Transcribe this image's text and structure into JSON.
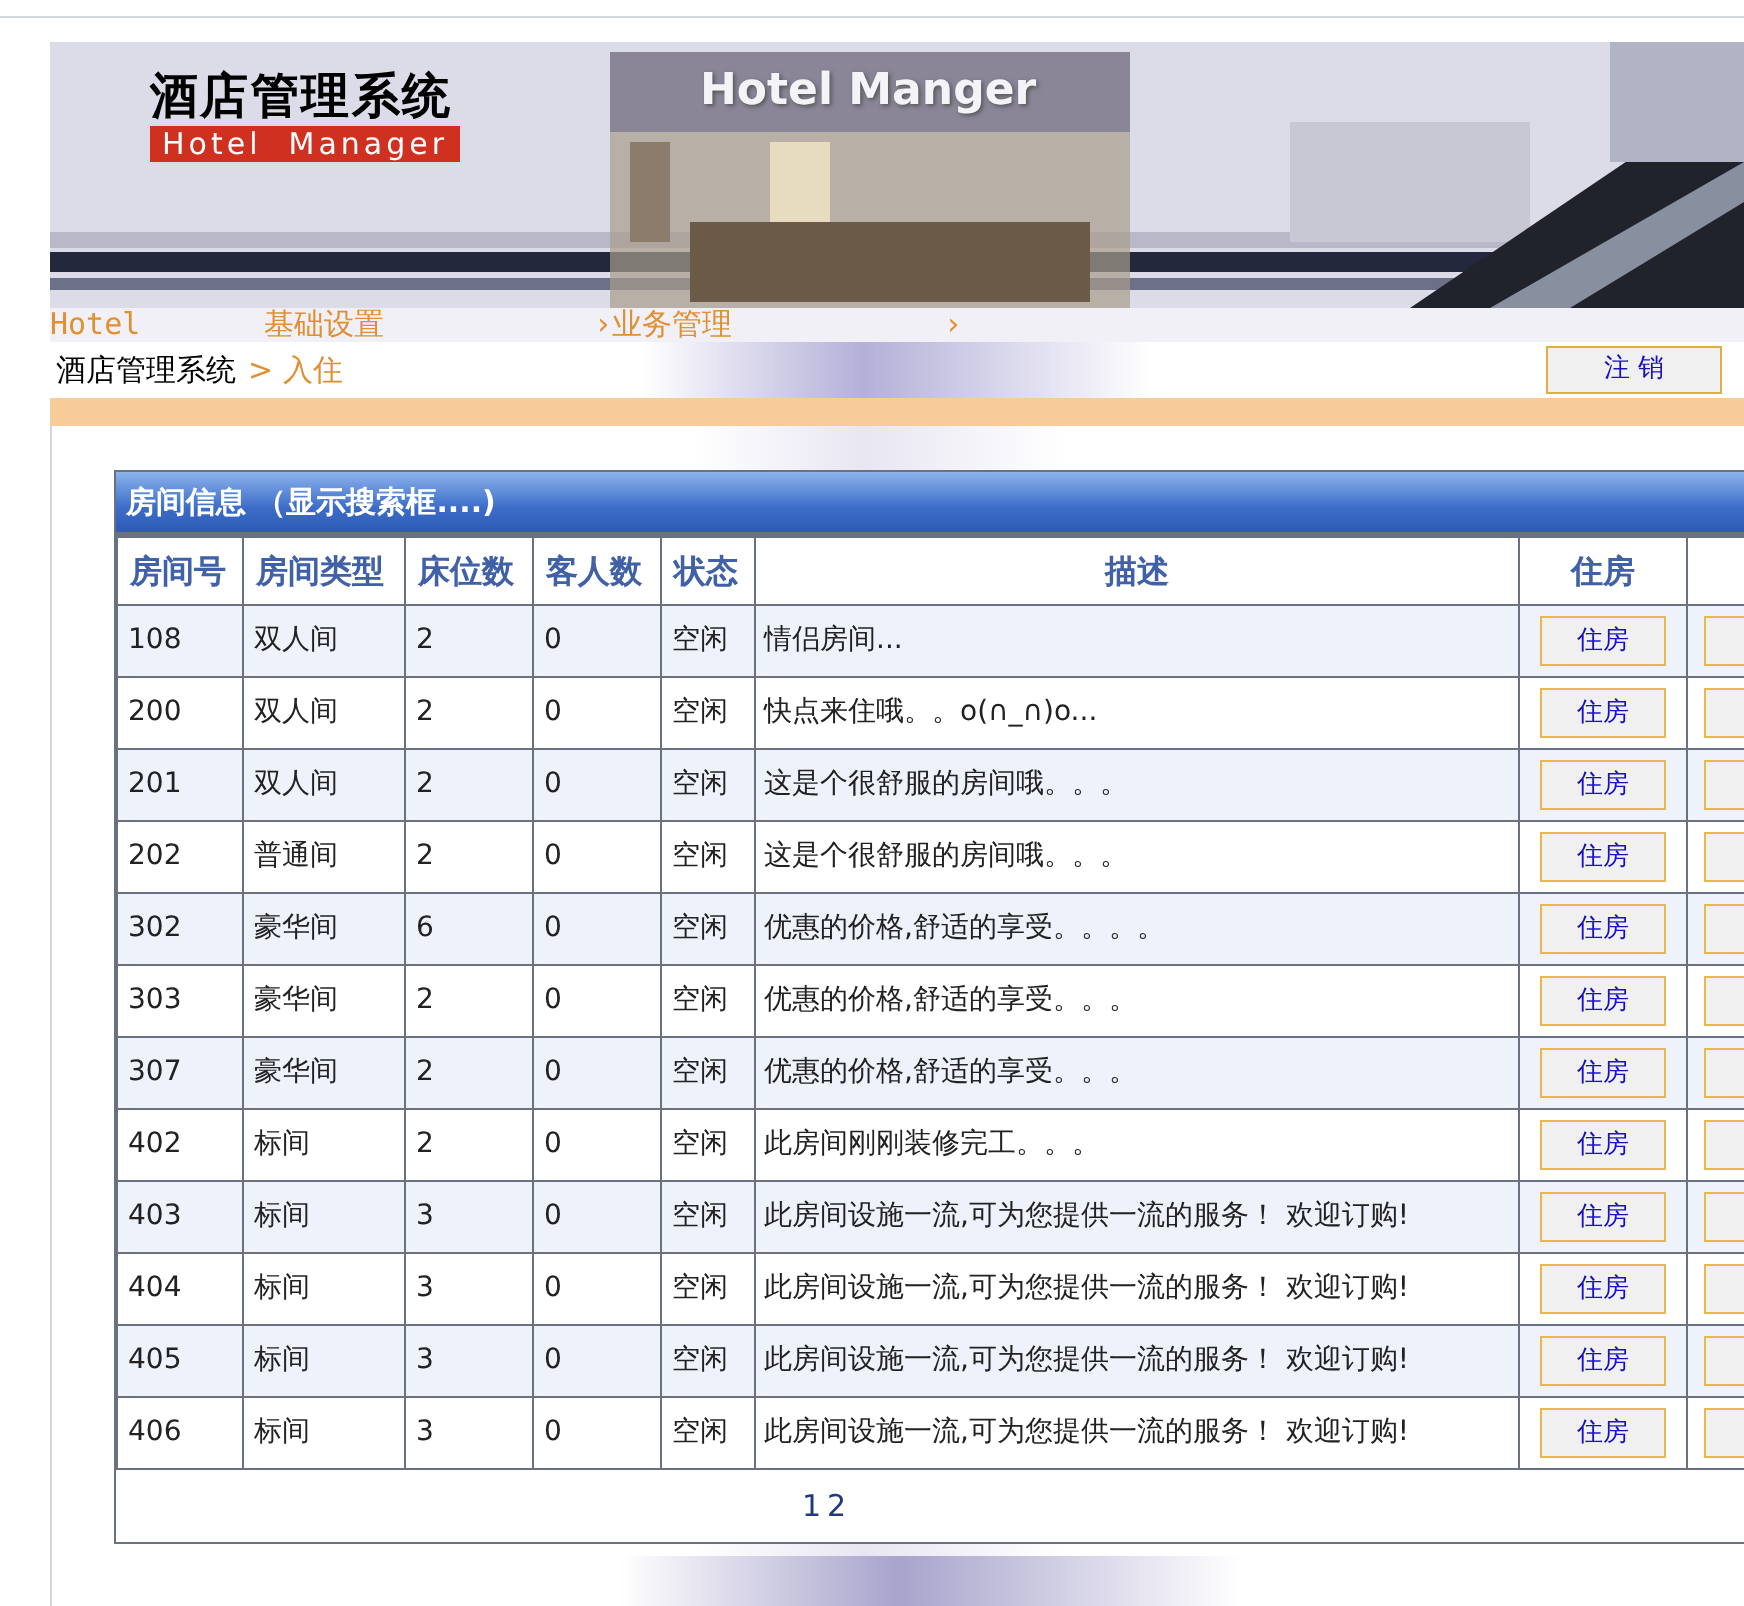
{
  "banner": {
    "title": "酒店管理系统",
    "subtitle": "Hotel  Manager",
    "caption": "Hotel Manger"
  },
  "nav": [
    "Hotel",
    "基础设置",
    "›业务管理",
    "›"
  ],
  "breadcrumb": {
    "root": "酒店管理系统",
    "current": "> 入住"
  },
  "logout_button": "注 销",
  "panel": {
    "title": "房间信息 （显示搜索框....)"
  },
  "table": {
    "columns": [
      "房间号",
      "房间类型",
      "床位数",
      "客人数",
      "状态",
      "描述",
      "住房"
    ],
    "rows": [
      {
        "number": "108",
        "type": "双人间",
        "beds": "2",
        "guests": "0",
        "status": "空闲",
        "description": "情侣房间...",
        "action": "住房"
      },
      {
        "number": "200",
        "type": "双人间",
        "beds": "2",
        "guests": "0",
        "status": "空闲",
        "description": "快点来住哦。。o(∩_∩)o...",
        "action": "住房"
      },
      {
        "number": "201",
        "type": "双人间",
        "beds": "2",
        "guests": "0",
        "status": "空闲",
        "description": "这是个很舒服的房间哦。。。",
        "action": "住房"
      },
      {
        "number": "202",
        "type": "普通间",
        "beds": "2",
        "guests": "0",
        "status": "空闲",
        "description": "这是个很舒服的房间哦。。。",
        "action": "住房"
      },
      {
        "number": "302",
        "type": "豪华间",
        "beds": "6",
        "guests": "0",
        "status": "空闲",
        "description": "优惠的价格,舒适的享受。。。。",
        "action": "住房"
      },
      {
        "number": "303",
        "type": "豪华间",
        "beds": "2",
        "guests": "0",
        "status": "空闲",
        "description": "优惠的价格,舒适的享受。。。",
        "action": "住房"
      },
      {
        "number": "307",
        "type": "豪华间",
        "beds": "2",
        "guests": "0",
        "status": "空闲",
        "description": "优惠的价格,舒适的享受。。。",
        "action": "住房"
      },
      {
        "number": "402",
        "type": "标间",
        "beds": "2",
        "guests": "0",
        "status": "空闲",
        "description": "此房间刚刚装修完工。。。",
        "action": "住房"
      },
      {
        "number": "403",
        "type": "标间",
        "beds": "3",
        "guests": "0",
        "status": "空闲",
        "description": "此房间设施一流,可为您提供一流的服务！  欢迎订购!",
        "action": "住房"
      },
      {
        "number": "404",
        "type": "标间",
        "beds": "3",
        "guests": "0",
        "status": "空闲",
        "description": "此房间设施一流,可为您提供一流的服务！  欢迎订购!",
        "action": "住房"
      },
      {
        "number": "405",
        "type": "标间",
        "beds": "3",
        "guests": "0",
        "status": "空闲",
        "description": "此房间设施一流,可为您提供一流的服务！  欢迎订购!",
        "action": "住房"
      },
      {
        "number": "406",
        "type": "标间",
        "beds": "3",
        "guests": "0",
        "status": "空闲",
        "description": "此房间设施一流,可为您提供一流的服务！  欢迎订购!",
        "action": "住房"
      }
    ]
  },
  "pagination": [
    "1",
    "2"
  ]
}
